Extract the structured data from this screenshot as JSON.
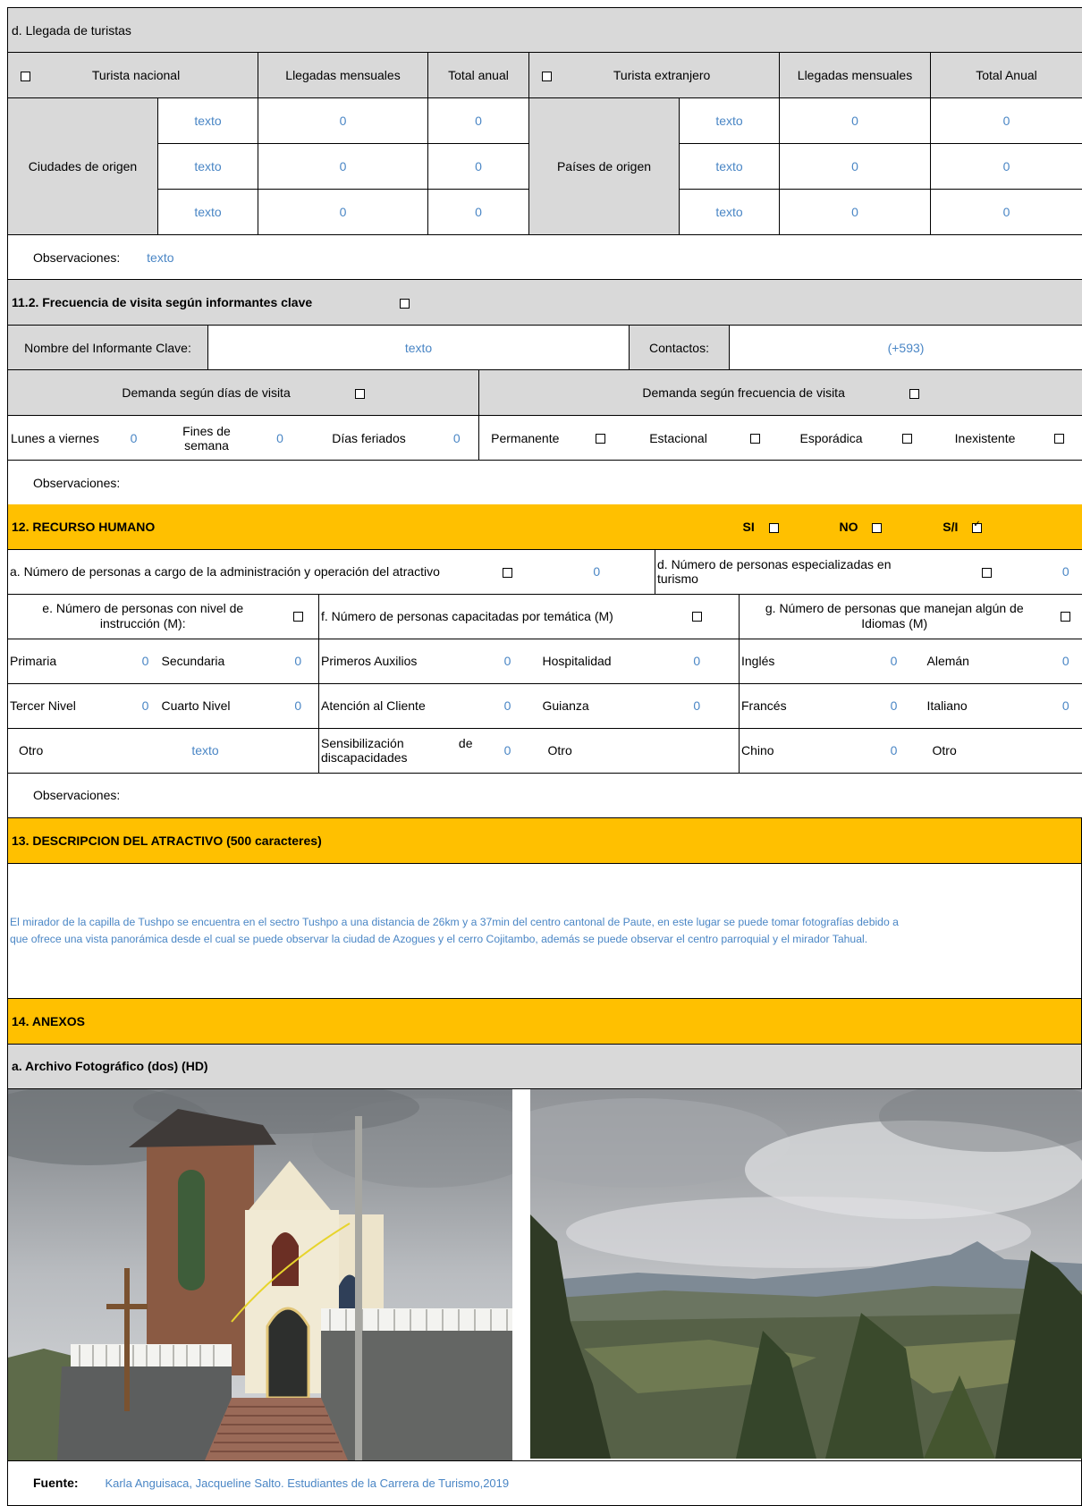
{
  "llegada": {
    "title": "d. Llegada de turistas",
    "nacional_label": "Turista nacional",
    "mensuales_label": "Llegadas mensuales",
    "anual_label": "Total anual",
    "extranjero_label": "Turista extranjero",
    "mensuales2_label": "Llegadas mensuales",
    "anual2_label": "Total Anual",
    "ciudades_label": "Ciudades de origen",
    "paises_label": "Países de origen",
    "rows": [
      {
        "c": "texto",
        "cm": "0",
        "ca": "0",
        "p": "texto",
        "pm": "0",
        "pa": "0"
      },
      {
        "c": "texto",
        "cm": "0",
        "ca": "0",
        "p": "texto",
        "pm": "0",
        "pa": "0"
      },
      {
        "c": "texto",
        "cm": "0",
        "ca": "0",
        "p": "texto",
        "pm": "0",
        "pa": "0"
      }
    ],
    "obs_label": "Observaciones:",
    "obs_value": "texto"
  },
  "frecuencia": {
    "title": "11.2. Frecuencia de visita según informantes clave",
    "informante_label": "Nombre del Informante Clave:",
    "informante_value": "texto",
    "contactos_label": "Contactos:",
    "contactos_value": "(+593)",
    "demanda_dias": "Demanda según  días de visita",
    "demanda_frec": "Demanda según frecuencia de visita",
    "lunes_label": "Lunes a viernes",
    "lunes_value": "0",
    "fines_label": "Fines de semana",
    "fines_value": "0",
    "feriados_label": "Días feriados",
    "feriados_value": "0",
    "permanente": "Permanente",
    "estacional": "Estacional",
    "esporadica": "Esporádica",
    "inexistente": "Inexistente",
    "obs_label": "Observaciones:"
  },
  "recurso": {
    "title": "12. RECURSO HUMANO",
    "si": "SI",
    "no": "NO",
    "si_no_info": "S/I",
    "a_label": "a. Número de personas a cargo de la administración y operación del atractivo",
    "a_value": "0",
    "d_label": "d. Número de personas especializadas en turismo",
    "d_value": "0",
    "e_label": "e. Número de personas con nivel de instrucción (M):",
    "f_label": "f. Número de personas capacitadas por temática (M)",
    "g_label": "g. Número de personas que manejan algún de Idiomas (M)",
    "primaria": "Primaria",
    "primaria_v": "0",
    "secundaria": "Secundaria",
    "secundaria_v": "0",
    "primeros": "Primeros Auxilios",
    "primeros_v": "0",
    "hospitalidad": "Hospitalidad",
    "hospitalidad_v": "0",
    "ingles": "Inglés",
    "ingles_v": "0",
    "aleman": "Alemán",
    "aleman_v": "0",
    "tercer": "Tercer Nivel",
    "tercer_v": "0",
    "cuarto": "Cuarto Nivel",
    "cuarto_v": "0",
    "atencion": "Atención al Cliente",
    "atencion_v": "0",
    "guianza": "Guianza",
    "guianza_v": "0",
    "frances": "Francés",
    "frances_v": "0",
    "italiano": "Italiano",
    "italiano_v": "0",
    "otro1": "Otro",
    "otro1_v": "texto",
    "sensib": "Sensibilización",
    "sensib_de": "de",
    "sensib2": "discapacidades",
    "sensib_v": "0",
    "otro2": "Otro",
    "chino": "Chino",
    "chino_v": "0",
    "otro3": "Otro",
    "obs_label": "Observaciones:"
  },
  "descripcion": {
    "title": "13. DESCRIPCION DEL ATRACTIVO (500 caracteres)",
    "line1": "El mirador de la capilla de Tushpo se encuentra en el sectro Tushpo a una distancia de 26km y a 37min del centro cantonal de Paute, en este lugar se puede tomar fotografías debido a",
    "line2": "que ofrece una vista panorámica desde el cual se puede observar la ciudad de Azogues y el cerro Cojitambo, además se puede observar el centro parroquial y el mirador Tahual."
  },
  "anexos": {
    "title": "14. ANEXOS",
    "archivo": "a. Archivo Fotográfico (dos) (HD)",
    "fuente_label": "Fuente:",
    "fuente_value": "Karla Anguisaca, Jacqueline Salto. Estudiantes de la Carrera de Turismo,2019"
  },
  "colors": {
    "header_gold": "#ffc000",
    "gray": "#d9d9d9",
    "value_blue": "#4a86c5"
  }
}
